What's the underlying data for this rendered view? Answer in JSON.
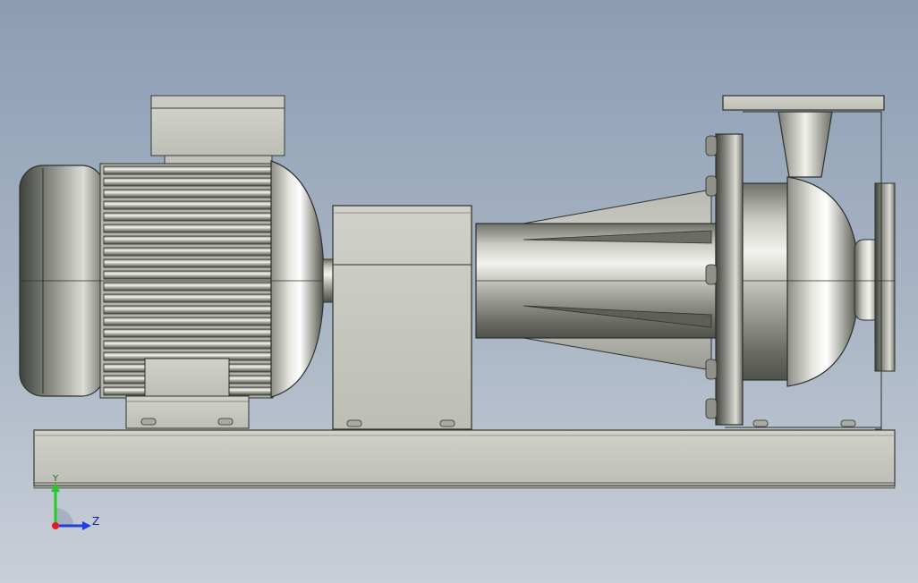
{
  "viewport": {
    "background_top": "#8c9db3",
    "background_bottom": "#c9cfd8"
  },
  "triad": {
    "y_label": "Y",
    "z_label": "Z",
    "y_color": "#22cc22",
    "z_color": "#1f3fe0",
    "origin_color": "#e02020"
  },
  "model": {
    "name_icon": "centrifugal-pump-motor-assembly",
    "metal_color": "#b9bbb2",
    "base_color": "#c4c4bb"
  }
}
